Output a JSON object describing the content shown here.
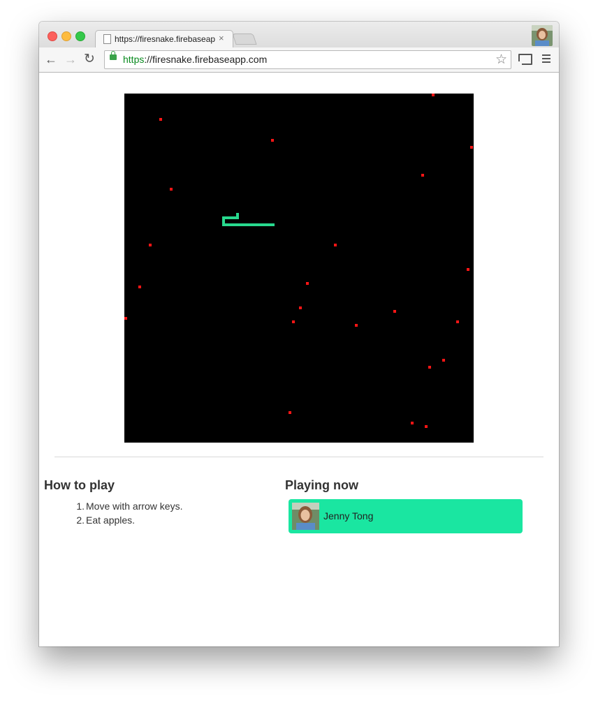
{
  "browser": {
    "tab_title": "https://firesnake.firebaseap",
    "tab_close": "×",
    "url_scheme": "https",
    "url_rest": "://firesnake.firebaseapp.com",
    "back_icon": "←",
    "forward_icon": "→",
    "reload_icon": "↻",
    "star_icon": "☆"
  },
  "game": {
    "board_color": "#000000",
    "apple_color": "#ff1515",
    "snake_color": "#28d98e"
  },
  "how_to_play": {
    "heading": "How to play",
    "steps": [
      {
        "num": "1.",
        "text": "Move with arrow keys."
      },
      {
        "num": "2.",
        "text": "Eat apples."
      }
    ]
  },
  "playing_now": {
    "heading": "Playing now",
    "players": [
      {
        "name": "Jenny Tong",
        "card_color": "#1ae6a1"
      }
    ]
  }
}
